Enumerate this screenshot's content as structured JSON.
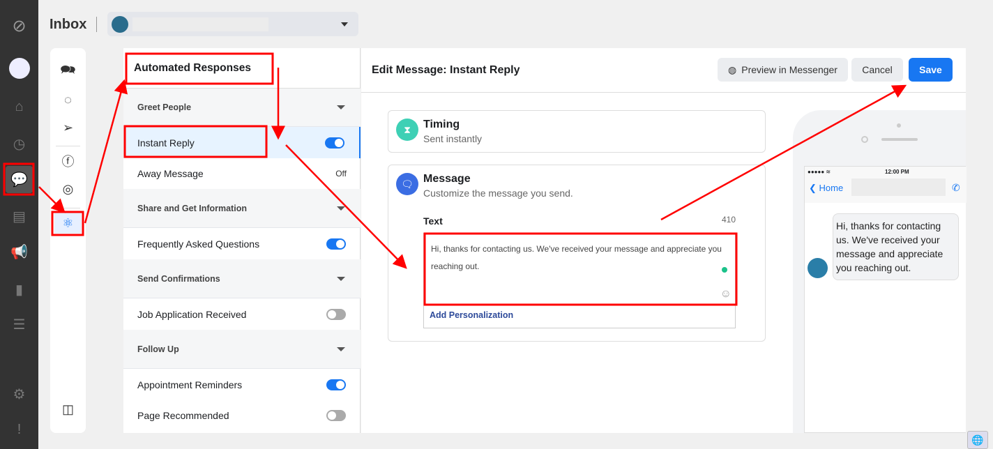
{
  "nav": {
    "items": [
      "logo-icon",
      "page-avatar",
      "home-icon",
      "clock-icon",
      "inbox-icon",
      "posts-icon",
      "megaphone-icon",
      "insights-icon",
      "menu-icon",
      "gear-icon",
      "feedback-icon"
    ],
    "active": "inbox-icon"
  },
  "header": {
    "title": "Inbox",
    "page_selector": ""
  },
  "icon_column": [
    "all-messages-icon",
    "messenger-icon",
    "send-icon",
    "facebook-icon",
    "instagram-icon",
    "automations-icon",
    "collapse-icon"
  ],
  "list": {
    "title": "Automated Responses",
    "sections": [
      {
        "label": "Greet People",
        "items": [
          {
            "label": "Instant Reply",
            "state": "on",
            "selected": true
          },
          {
            "label": "Away Message",
            "state": "Off"
          }
        ]
      },
      {
        "label": "Share and Get Information",
        "items": [
          {
            "label": "Frequently Asked Questions",
            "state": "on"
          }
        ]
      },
      {
        "label": "Send Confirmations",
        "items": [
          {
            "label": "Job Application Received",
            "state": "off"
          }
        ]
      },
      {
        "label": "Follow Up",
        "items": [
          {
            "label": "Appointment Reminders",
            "state": "on"
          },
          {
            "label": "Page Recommended",
            "state": "off"
          }
        ]
      }
    ]
  },
  "editor": {
    "title": "Edit Message: Instant Reply",
    "preview_label": "Preview in Messenger",
    "cancel_label": "Cancel",
    "save_label": "Save",
    "save_color": "#1877f2",
    "timing": {
      "title": "Timing",
      "subtitle": "Sent instantly"
    },
    "message": {
      "title": "Message",
      "subtitle": "Customize the message you send.",
      "text_label": "Text",
      "char_count": "410",
      "text": "Hi, thanks for contacting us. We've received your message and appreciate you reaching out.",
      "add_personalization": "Add Personalization"
    }
  },
  "preview": {
    "time": "12:00 PM",
    "back_label": "Home",
    "bubble": "Hi, thanks for contacting us. We've received your message and appreciate you reaching out."
  }
}
